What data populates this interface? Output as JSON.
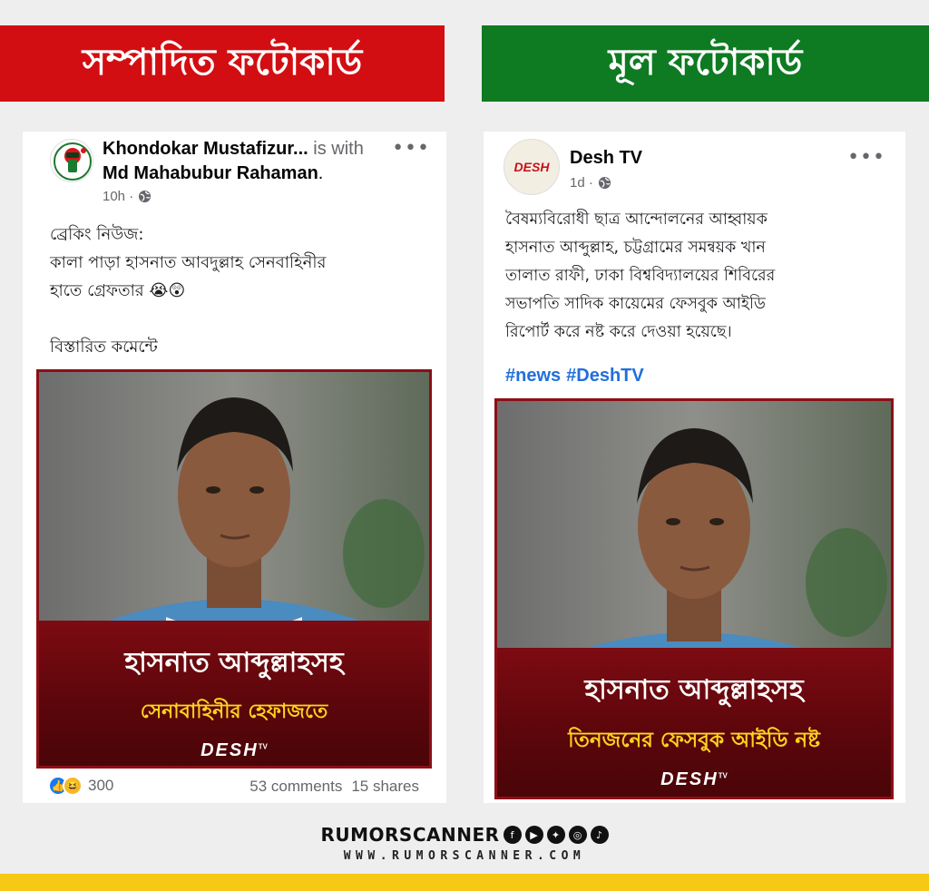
{
  "banners": {
    "left": "সম্পাদিত ফটোকার্ড",
    "right": "মূল ফটোকার্ড"
  },
  "left_post": {
    "author": "Khondokar Mustafizur...",
    "with_text": "is with",
    "tagged": "Md Mahabubur Rahaman",
    "tagged_suffix": ".",
    "time": "10h ·",
    "lines": [
      "ব্রেকিং নিউজ:",
      "কালা পাড়া হাসনাত আবদুল্লাহ সেনবাহিনীর",
      "হাতে গ্রেফতার 😭😲",
      "",
      "বিস্তারিত কমেন্টে"
    ],
    "caption_line1": "হাসনাত আব্দুল্লাহসহ",
    "caption_line2": "সেনাবাহিনীর হেফাজতে",
    "caption_logo": "DESH",
    "caption_logo_tm": "TV",
    "reaction_count": "300",
    "comments": "53 comments",
    "shares": "15 shares"
  },
  "right_post": {
    "author": "Desh TV",
    "avatar_text": "DESH",
    "time": "1d ·",
    "lines": [
      "বৈষম্যবিরোধী ছাত্র আন্দোলনের আহ্বায়ক",
      "হাসনাত আব্দুল্লাহ, চট্টগ্রামের সমন্বয়ক খান",
      "তালাত রাফী, ঢাকা বিশ্ববিদ্যালয়ের শিবিরের",
      "সভাপতি সাদিক কায়েমের ফেসবুক আইডি",
      "রিপোর্ট করে নষ্ট করে দেওয়া হয়েছে।"
    ],
    "hashtags": [
      "#news",
      "#DeshTV"
    ],
    "caption_line1": "হাসনাত আব্দুল্লাহসহ",
    "caption_line2": "তিনজনের ফেসবুক আইডি নষ্ট",
    "caption_logo": "DESH",
    "caption_logo_tm": "TV"
  },
  "footer": {
    "brand": "RUMORSCANNER",
    "url": "WWW.RUMORSCANNER.COM",
    "social_icons": [
      "facebook-icon",
      "youtube-icon",
      "twitter-icon",
      "instagram-icon",
      "tiktok-icon"
    ]
  },
  "colors": {
    "left_banner": "#d20e12",
    "right_banner": "#0e7a22",
    "caption_bg": "#5a060b",
    "caption_highlight": "#ffd21f",
    "hashtag": "#216fdb",
    "bottom_bar": "#f6c915"
  }
}
